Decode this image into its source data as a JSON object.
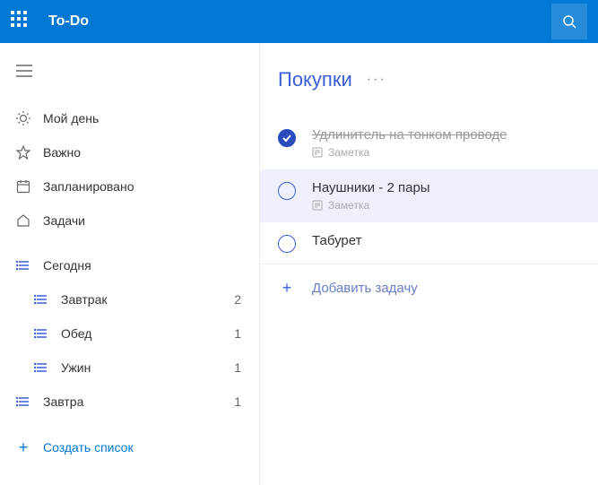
{
  "header": {
    "app_title": "To-Do"
  },
  "sidebar": {
    "smart_lists": [
      {
        "icon": "sun",
        "label": "Мой день"
      },
      {
        "icon": "star",
        "label": "Важно"
      },
      {
        "icon": "calendar",
        "label": "Запланировано"
      },
      {
        "icon": "home",
        "label": "Задачи"
      }
    ],
    "user_lists": [
      {
        "icon": "list",
        "label": "Сегодня",
        "count": "",
        "children": [
          {
            "icon": "list",
            "label": "Завтрак",
            "count": "2"
          },
          {
            "icon": "list",
            "label": "Обед",
            "count": "1"
          },
          {
            "icon": "list",
            "label": "Ужин",
            "count": "1"
          }
        ]
      },
      {
        "icon": "list",
        "label": "Завтра",
        "count": "1"
      }
    ],
    "new_list_label": "Создать список"
  },
  "main": {
    "title": "Покупки",
    "tasks": [
      {
        "done": true,
        "title": "Удлинитель на тонком проводе",
        "note": "Заметка",
        "selected": false
      },
      {
        "done": false,
        "title": "Наушники - 2 пары",
        "note": "Заметка",
        "selected": true
      },
      {
        "done": false,
        "title": "Табурет",
        "note": "",
        "selected": false
      }
    ],
    "add_task_label": "Добавить задачу",
    "note_word": "Заметка"
  }
}
